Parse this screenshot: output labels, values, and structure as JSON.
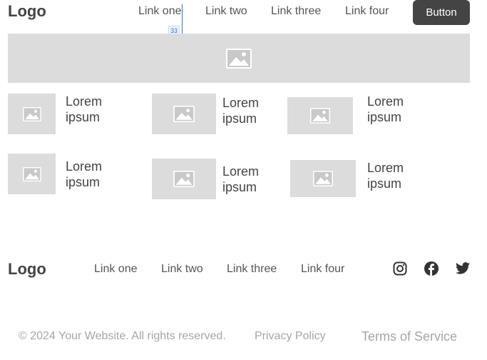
{
  "header": {
    "logo": "Logo",
    "nav": [
      "Link one",
      "Link two",
      "Link three",
      "Link four"
    ],
    "button": "Button",
    "guide_value": "33"
  },
  "hero": {
    "icon": "image-icon"
  },
  "cards": [
    {
      "title": "Lorem ipsum"
    },
    {
      "title": "Lorem ipsum"
    },
    {
      "title": "Lorem ipsum"
    },
    {
      "title": "Lorem ipsum"
    },
    {
      "title": "Lorem ipsum"
    },
    {
      "title": "Lorem ipsum"
    }
  ],
  "footer": {
    "logo": "Logo",
    "nav": [
      "Link one",
      "Link two",
      "Link three",
      "Link four"
    ],
    "social": [
      "instagram-icon",
      "facebook-icon",
      "twitter-icon"
    ],
    "copyright": "© 2024 Your Website. All rights reserved.",
    "privacy": "Privacy Policy",
    "terms": "Terms of Service"
  },
  "colors": {
    "placeholder_bg": "#dcdcdc",
    "placeholder_icon": "#ffffff",
    "button_bg": "#444444",
    "guide": "#2f6fd6"
  }
}
